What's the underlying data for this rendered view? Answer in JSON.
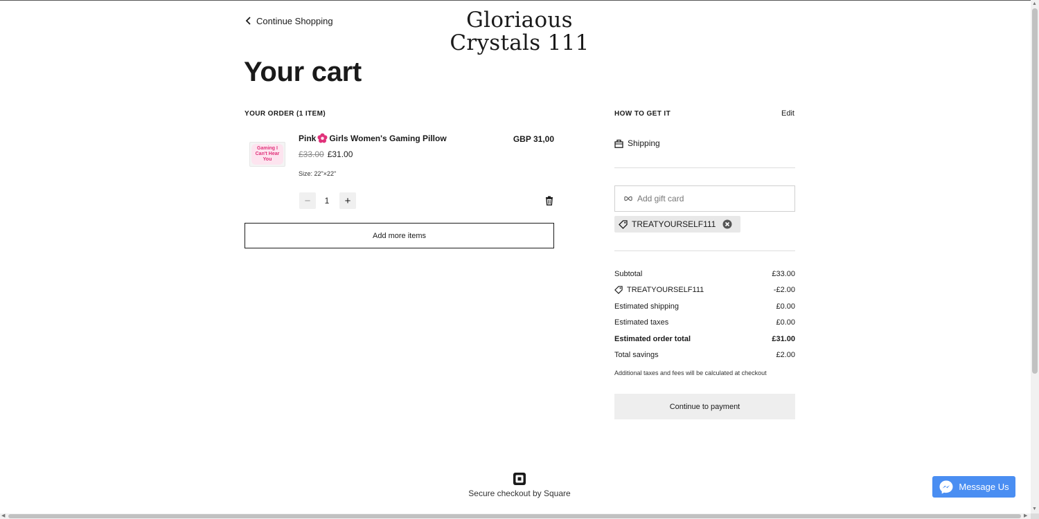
{
  "header": {
    "continue_label": "Continue Shopping",
    "brand_line1": "Gloriaous",
    "brand_line2": "Crystals 111"
  },
  "page_title": "Your cart",
  "order": {
    "section_label": "YOUR ORDER (1 ITEM)",
    "items": [
      {
        "name": "Pink",
        "name_rest": "Girls Women's Gaming Pillow",
        "name_icon": "pink-flower-emoji-icon",
        "image_text": "Gaming I Can't Hear You",
        "original_price": "£33.00",
        "price": "£31.00",
        "line_total": "GBP 31,00",
        "size": "Size: 22\"×22\"",
        "quantity": "1"
      }
    ],
    "add_more_label": "Add more items"
  },
  "fulfillment": {
    "section_label": "HOW TO GET IT",
    "edit_label": "Edit",
    "method": "Shipping"
  },
  "gift_card": {
    "placeholder": "Add gift card"
  },
  "promo": {
    "code": "TREATYOURSELF111"
  },
  "summary": {
    "rows": [
      {
        "label": "Subtotal",
        "value": "£33.00"
      },
      {
        "label": "TREATYOURSELF111",
        "value": "-£2.00"
      },
      {
        "label": "Estimated shipping",
        "value": "£0.00"
      },
      {
        "label": "Estimated taxes",
        "value": "£0.00"
      },
      {
        "label": "Estimated order total",
        "value": "£31.00"
      },
      {
        "label": "Total savings",
        "value": "£2.00"
      }
    ],
    "note": "Additional taxes and fees will be calculated at checkout",
    "pay_label": "Continue to payment"
  },
  "footer": {
    "secure_text": "Secure checkout by Square"
  },
  "chat": {
    "label": "Message Us"
  },
  "colors": {
    "messenger_blue": "#4a8ef2",
    "flower_pink": "#e0327a"
  }
}
